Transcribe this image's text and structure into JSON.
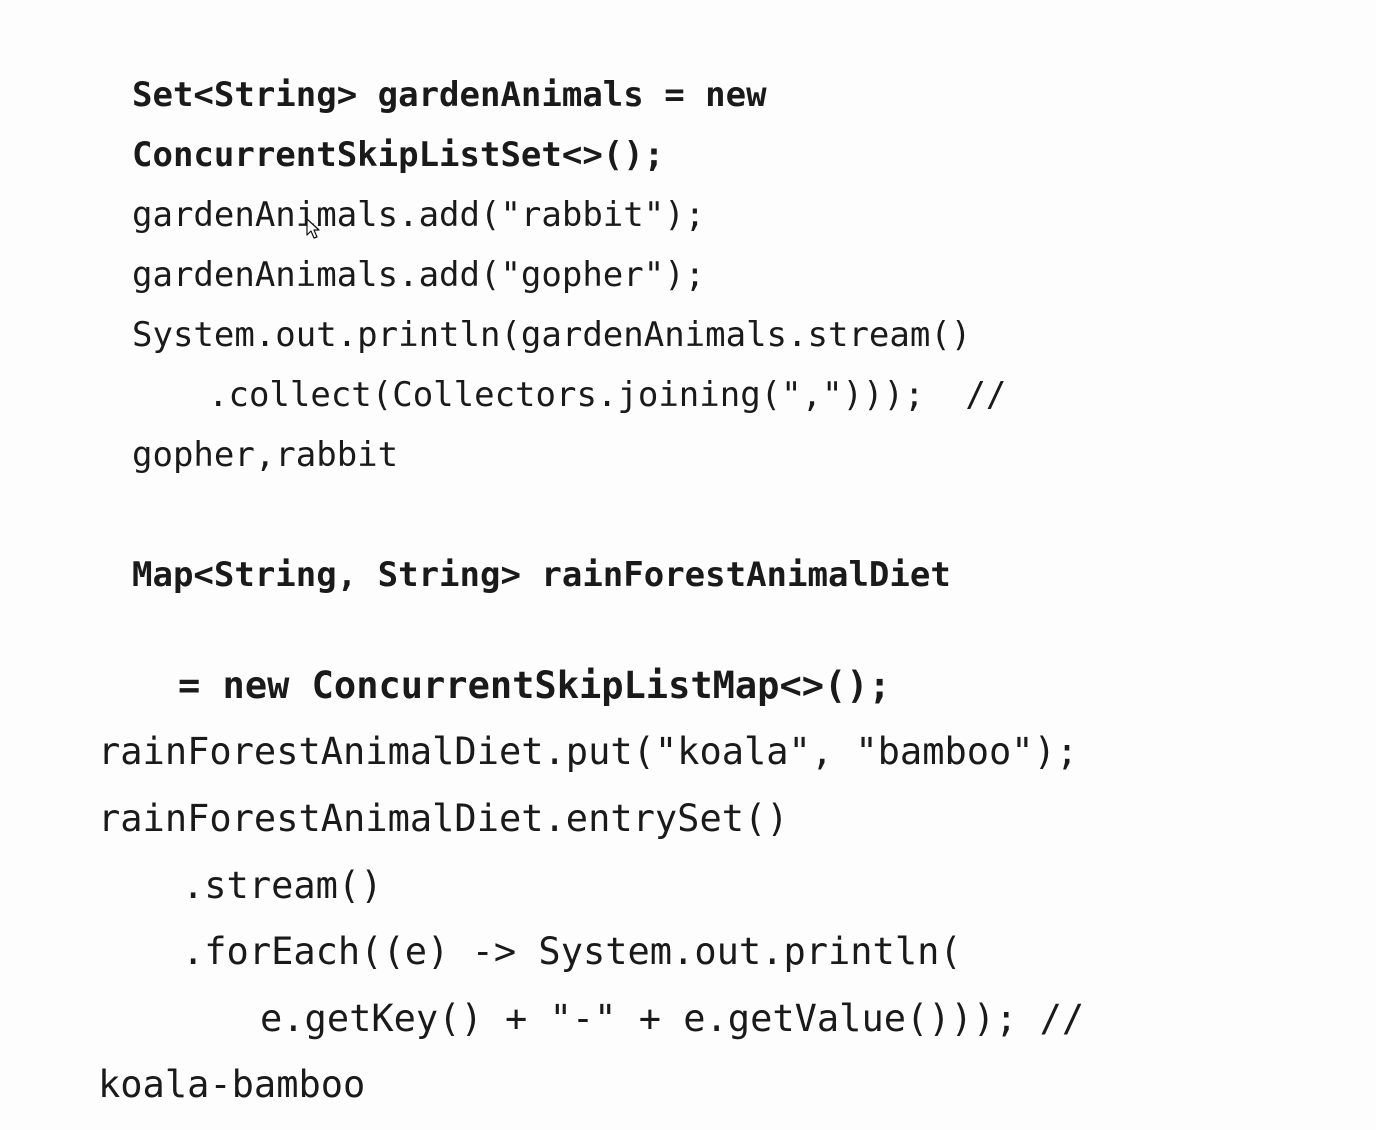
{
  "code": {
    "block1": {
      "line1": "Set<String> gardenAnimals = new",
      "line2": "ConcurrentSkipListSet<>();",
      "line3": "gardenAnimals.add(\"rabbit\");",
      "line4": "gardenAnimals.add(\"gopher\");",
      "line5": "System.out.println(gardenAnimals.stream()",
      "line6": ".collect(Collectors.joining(\",\")));  //",
      "line7": "gopher,rabbit"
    },
    "block2": {
      "line1": "Map<String, String> rainForestAnimalDiet",
      "line2": "= new ConcurrentSkipListMap<>();",
      "line3": "rainForestAnimalDiet.put(\"koala\", \"bamboo\");",
      "line4": "rainForestAnimalDiet.entrySet()",
      "line5": ".stream()",
      "line6": ".forEach((e) -> System.out.println(",
      "line7": "e.getKey() + \"-\" + e.getValue())); //",
      "line8": "koala-bamboo"
    }
  }
}
